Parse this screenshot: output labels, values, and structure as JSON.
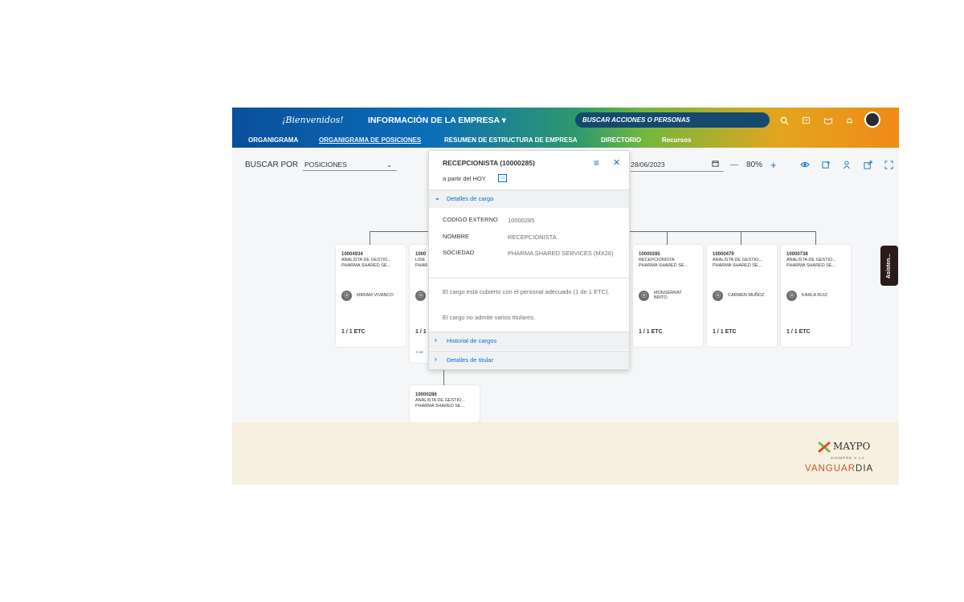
{
  "header": {
    "welcome": "¡Bienvenidos!",
    "company_menu": "INFORMACIÓN DE LA EMPRESA ▾",
    "search_placeholder": "BUSCAR ACCIONES O PERSONAS"
  },
  "nav": {
    "items": [
      "ORGANIGRAMA",
      "ORGANIGRAMA DE POSICIONES",
      "RESUMEN DE ESTRUCTURA DE EMPRESA",
      "DIRECTORIO",
      "Recursos"
    ],
    "active": "ORGANIGRAMA DE POSICIONES"
  },
  "toolbar": {
    "search_by_label": "BUSCAR POR",
    "search_by_value": "POSICIONES",
    "date_value": "28/06/2023",
    "zoom_minus": "—",
    "zoom_value": "80%",
    "zoom_plus": "+"
  },
  "cards": [
    {
      "id": "10004934",
      "title": "ANALISTA DE GESTIO...",
      "org": "PHARMA SHARED SE...",
      "holder": "MIRIAM VIVANCO",
      "etc": "1 / 1 ETC"
    },
    {
      "id": "1000",
      "title": "LIDE",
      "org": "PHAR",
      "holder": "",
      "etc": "1 / 1",
      "extra": "1 car"
    },
    {
      "id": "10000285",
      "title": "RECEPCIONISTA",
      "org": "PHARMA SHARED SE...",
      "holder": "MONSERRAT BRITO",
      "etc": "1 / 1 ETC"
    },
    {
      "id": "10000479",
      "title": "ANALISTA DE GESTIO...",
      "org": "PHARMA SHARED SE...",
      "holder": "CARMEN MUÑOZ",
      "etc": "1 / 1 ETC"
    },
    {
      "id": "10000738",
      "title": "ANALISTA DE GESTIO...",
      "org": "PHARMA SHARED SE...",
      "holder": "KARLA RUIZ",
      "etc": "1 / 1 ETC"
    },
    {
      "id": "10000286",
      "title": "ANALISTA DE GESTIO...",
      "org": "PHARMA SHARED SE...",
      "holder": "",
      "etc": ""
    }
  ],
  "side_tab": "Asisten...",
  "popover": {
    "title": "RECEPCIONISTA (10000285)",
    "subtitle": "a partir del HOY",
    "section_details": "Detalles de cargo",
    "fields": [
      {
        "key": "CODIGO EXTERNO",
        "value": "10000285"
      },
      {
        "key": "NOMBRE",
        "value": "RECEPCIONISTA"
      },
      {
        "key": "SOCIEDAD",
        "value": "PHARMA SHARED SERVICES (MX26)"
      }
    ],
    "note1": "El cargo está cubierto con el personal adecuado (1 de 1 ETC).",
    "note2": "El cargo no admite varios titulares.",
    "section_history": "Historial de cargos",
    "section_holder": "Detalles de titular"
  },
  "footer": {
    "brand": "MAYPO",
    "tagline": "SIEMPRE A LA",
    "brand2_a": "VANGUAR",
    "brand2_b": "DIA",
    "colors": {
      "brand2_a": "#c0582b",
      "brand2_b": "#32363a"
    }
  },
  "colors": {
    "accent": "#0a6ed1",
    "header_start": "#0a4f9c",
    "header_end": "#f08a17",
    "footer_bg": "#f7f0e1"
  }
}
